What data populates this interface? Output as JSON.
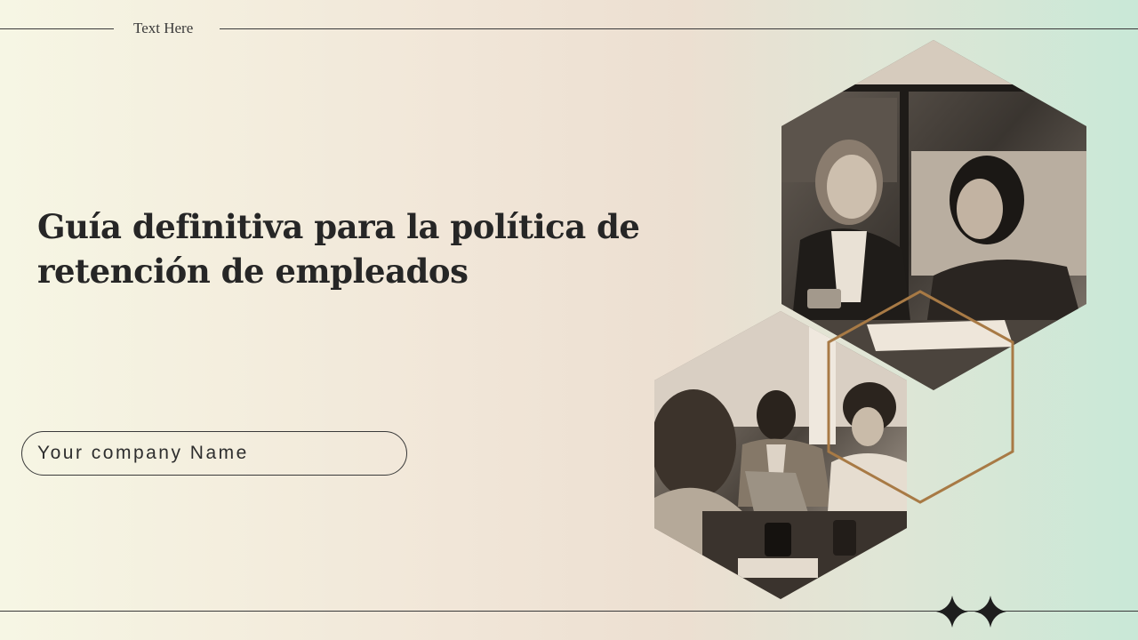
{
  "header": {
    "label": "Text Here"
  },
  "slide": {
    "title": "Guía definitiva para la política de retención de empleados",
    "company_name": "Your company Name"
  },
  "colors": {
    "accent_hex_outline": "#a87a45",
    "text_dark": "#262626"
  },
  "icons": {
    "decoration": "four-point-star-icon"
  }
}
